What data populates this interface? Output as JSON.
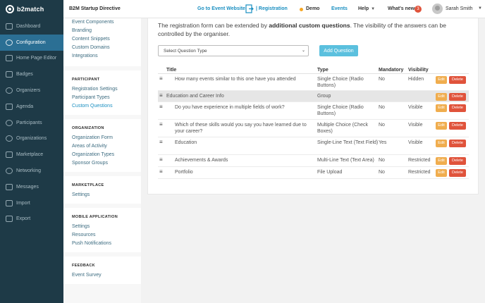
{
  "header": {
    "logo": "b2match",
    "event_name": "B2M Startup Directive",
    "links": {
      "event_website": "Go to Event Website",
      "registration": "| Registration",
      "demo": "Demo",
      "events": "Events",
      "help": "Help",
      "whats_new": "What's new",
      "whats_new_count": "3"
    },
    "user": "Sarah Smith",
    "colors": {
      "accent": "#1a8fc1",
      "sidebar": "#1e3a47",
      "demo_dot": "#f5a623"
    }
  },
  "sidebar": {
    "items": [
      {
        "label": "Dashboard",
        "icon": "dashboard-icon",
        "active": false
      },
      {
        "label": "Configuration",
        "icon": "configuration-icon",
        "active": true
      },
      {
        "label": "Home Page Editor",
        "icon": "home-page-icon",
        "active": false
      },
      {
        "label": "Badges",
        "icon": "badge-icon",
        "active": false
      },
      {
        "label": "Organizers",
        "icon": "organizers-icon",
        "active": false
      },
      {
        "label": "Agenda",
        "icon": "calendar-icon",
        "active": false
      },
      {
        "label": "Participants",
        "icon": "participants-icon",
        "active": false
      },
      {
        "label": "Organizations",
        "icon": "globe-icon",
        "active": false
      },
      {
        "label": "Marketplace",
        "icon": "marketplace-icon",
        "active": false
      },
      {
        "label": "Networking",
        "icon": "networking-icon",
        "active": false
      },
      {
        "label": "Messages",
        "icon": "envelope-icon",
        "active": false
      },
      {
        "label": "Import",
        "icon": "import-icon",
        "active": false
      },
      {
        "label": "Export",
        "icon": "export-icon",
        "active": false
      }
    ]
  },
  "subnav": {
    "top_links": [
      "Event Components",
      "Branding",
      "Content Snippets",
      "Custom Domains",
      "Integrations"
    ],
    "participant": {
      "title": "PARTICIPANT",
      "links": [
        "Registration Settings",
        "Participant Types",
        "Custom Questions"
      ]
    },
    "organization": {
      "title": "ORGANIZATION",
      "links": [
        "Organization Form",
        "Areas of Activity",
        "Organization Types",
        "Sponsor Groups"
      ]
    },
    "marketplace": {
      "title": "MARKETPLACE",
      "links": [
        "Settings"
      ]
    },
    "mobile": {
      "title": "MOBILE APPLICATION",
      "links": [
        "Settings",
        "Resources",
        "Push Notifications"
      ]
    },
    "feedback": {
      "title": "FEEDBACK",
      "links": [
        "Event Survey"
      ]
    }
  },
  "main": {
    "intro_prefix": "The registration form can be extended by ",
    "intro_bold": "additional custom questions",
    "intro_suffix": ". The visibility of the answers can be controlled by the organiser.",
    "select_placeholder": "Select Question Type",
    "add_button": "Add Question",
    "columns": {
      "title": "Title",
      "type": "Type",
      "mandatory": "Mandatory",
      "visibility": "Visibility"
    },
    "edit_label": "Edit",
    "delete_label": "Delete",
    "rows": [
      {
        "title": "How many events similar to this one have you attended",
        "type": "Single Choice (Radio Buttons)",
        "mandatory": "No",
        "visibility": "Hidden"
      },
      {
        "title": "Education and Career Info",
        "type": "Group",
        "mandatory": "",
        "visibility": ""
      },
      {
        "title": "Do you have experience in multiple fields of work?",
        "type": "Single Choice (Radio Buttons)",
        "mandatory": "No",
        "visibility": "Visible"
      },
      {
        "title": "Which of these skills would you say you have learned due to your career?",
        "type": "Multiple Choice (Check Boxes)",
        "mandatory": "No",
        "visibility": "Visible"
      },
      {
        "title": "Education",
        "type": "Single-Line Text (Text Field)",
        "mandatory": "Yes",
        "visibility": "Visible"
      },
      {
        "title": "Achievements & Awards",
        "type": "Multi-Line Text (Text Area)",
        "mandatory": "No",
        "visibility": "Restricted"
      },
      {
        "title": "Portfolio",
        "type": "File Upload",
        "mandatory": "No",
        "visibility": "Restricted"
      }
    ]
  }
}
